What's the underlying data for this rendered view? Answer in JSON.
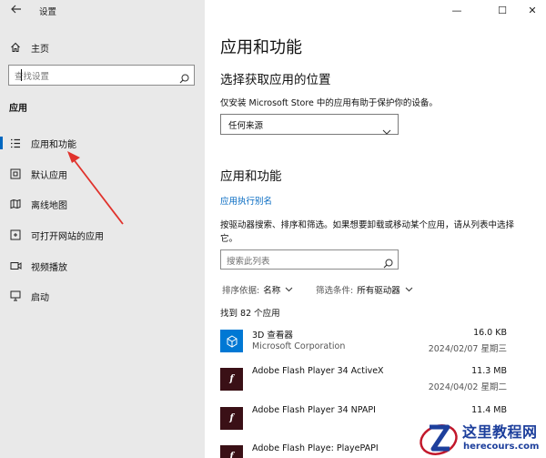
{
  "window": {
    "title": "设置",
    "minimize": "—",
    "maximize": "☐",
    "close": "✕"
  },
  "sidebar": {
    "home": "主页",
    "search_placeholder": "查找设置",
    "section": "应用",
    "items": [
      {
        "label": "应用和功能",
        "icon": "list-icon",
        "active": true
      },
      {
        "label": "默认应用",
        "icon": "default-apps-icon"
      },
      {
        "label": "离线地图",
        "icon": "map-icon"
      },
      {
        "label": "可打开网站的应用",
        "icon": "open-with-icon"
      },
      {
        "label": "视频播放",
        "icon": "video-icon"
      },
      {
        "label": "启动",
        "icon": "startup-icon"
      }
    ]
  },
  "main": {
    "title": "应用和功能",
    "source_heading": "选择获取应用的位置",
    "source_desc": "仅安装 Microsoft Store 中的应用有助于保护你的设备。",
    "source_value": "任何来源",
    "apps_heading": "应用和功能",
    "alias_link": "应用执行别名",
    "apps_desc": "按驱动器搜索、排序和筛选。如果想要卸载或移动某个应用，请从列表中选择它。",
    "apps_search_placeholder": "搜索此列表",
    "sort_label": "排序依据:",
    "sort_value": "名称",
    "filter_label": "筛选条件:",
    "filter_value": "所有驱动器",
    "count": "找到 82 个应用",
    "apps": [
      {
        "name": "3D 查看器",
        "publisher": "Microsoft Corporation",
        "size": "16.0 KB",
        "date": "2024/02/07 星期三",
        "icon": "cube-icon"
      },
      {
        "name": "Adobe Flash Player 34 ActiveX",
        "publisher": "",
        "size": "11.3 MB",
        "date": "2024/04/02 星期二",
        "icon": "flash-icon"
      },
      {
        "name": "Adobe Flash Player 34 NPAPI",
        "publisher": "",
        "size": "11.4 MB",
        "date": "",
        "icon": "flash-icon"
      },
      {
        "name": "Adobe Flash Playe: PlayePAPI",
        "publisher": "",
        "size": "",
        "date": "",
        "icon": "flash-icon"
      }
    ]
  },
  "watermark": {
    "title": "这里教程网",
    "url": "herecours.com"
  },
  "colors": {
    "accent": "#0067c0",
    "sidebar_bg": "#e9e9e9",
    "arrow": "#e0322c",
    "tile_blue": "#0078d4",
    "flash_tile": "#3a1016"
  }
}
